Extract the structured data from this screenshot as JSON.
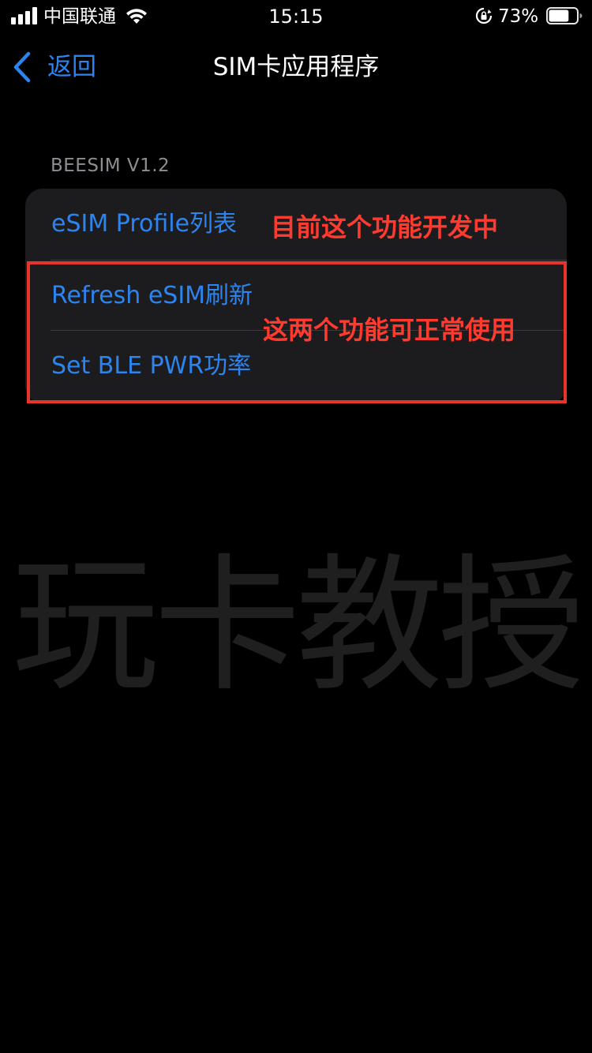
{
  "status_bar": {
    "carrier": "中国联通",
    "time": "15:15",
    "battery_percent": "73%",
    "battery_level": 0.73,
    "icons": [
      "signal-icon",
      "wifi-icon",
      "rotation-lock-icon",
      "battery-icon"
    ]
  },
  "nav": {
    "back_label": "返回",
    "title": "SIM卡应用程序"
  },
  "section": {
    "header": "BEESIM V1.2",
    "items": [
      {
        "label": "eSIM Profile列表"
      },
      {
        "label": "Refresh eSIM刷新"
      },
      {
        "label": "Set BLE PWR功率"
      }
    ]
  },
  "annotations": {
    "note_1": "目前这个功能开发中",
    "note_2": "这两个功能可正常使用"
  },
  "watermark": "玩卡教授",
  "colors": {
    "background": "#000000",
    "group_bg": "#1c1c1e",
    "link_blue": "#2d84ef",
    "annotation_red": "#ff3b30",
    "highlight_border": "#e8352a",
    "secondary_text": "#8d8d93"
  }
}
